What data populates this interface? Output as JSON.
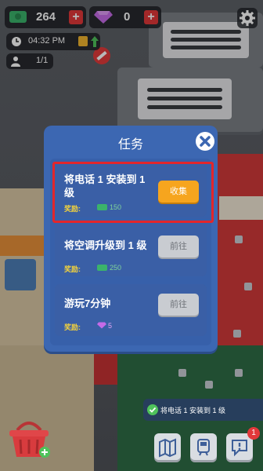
{
  "hud": {
    "cash": "264",
    "gems": "0",
    "time": "04:32 PM",
    "workers": "1/1"
  },
  "dialog": {
    "title": "任务",
    "reward_label": "奖励:",
    "tasks": [
      {
        "title_line1": "将电话 1 安装到 1",
        "title_line2": "级",
        "reward": "150",
        "reward_icon": "cash-icon",
        "button": "收集",
        "state": "collect"
      },
      {
        "title_line1": "将空调升级到 1 级",
        "title_line2": "",
        "reward": "250",
        "reward_icon": "cash-icon",
        "button": "前往",
        "state": "go"
      },
      {
        "title_line1": "游玩7分钟",
        "title_line2": "",
        "reward": "5",
        "reward_icon": "gem-icon",
        "button": "前往",
        "state": "go"
      }
    ]
  },
  "toast": {
    "text": "将电话 1 安装到 1 级"
  },
  "badges": {
    "messages": "1"
  },
  "colors": {
    "dialog_bg": "#3c67b2",
    "collect_button": "#f6a51e",
    "go_button": "#c9ccd1",
    "highlight": "#e3262b",
    "reward_label": "#f3d23c",
    "cash_green": "#3bb36b",
    "gem_purple": "#c66be8"
  }
}
